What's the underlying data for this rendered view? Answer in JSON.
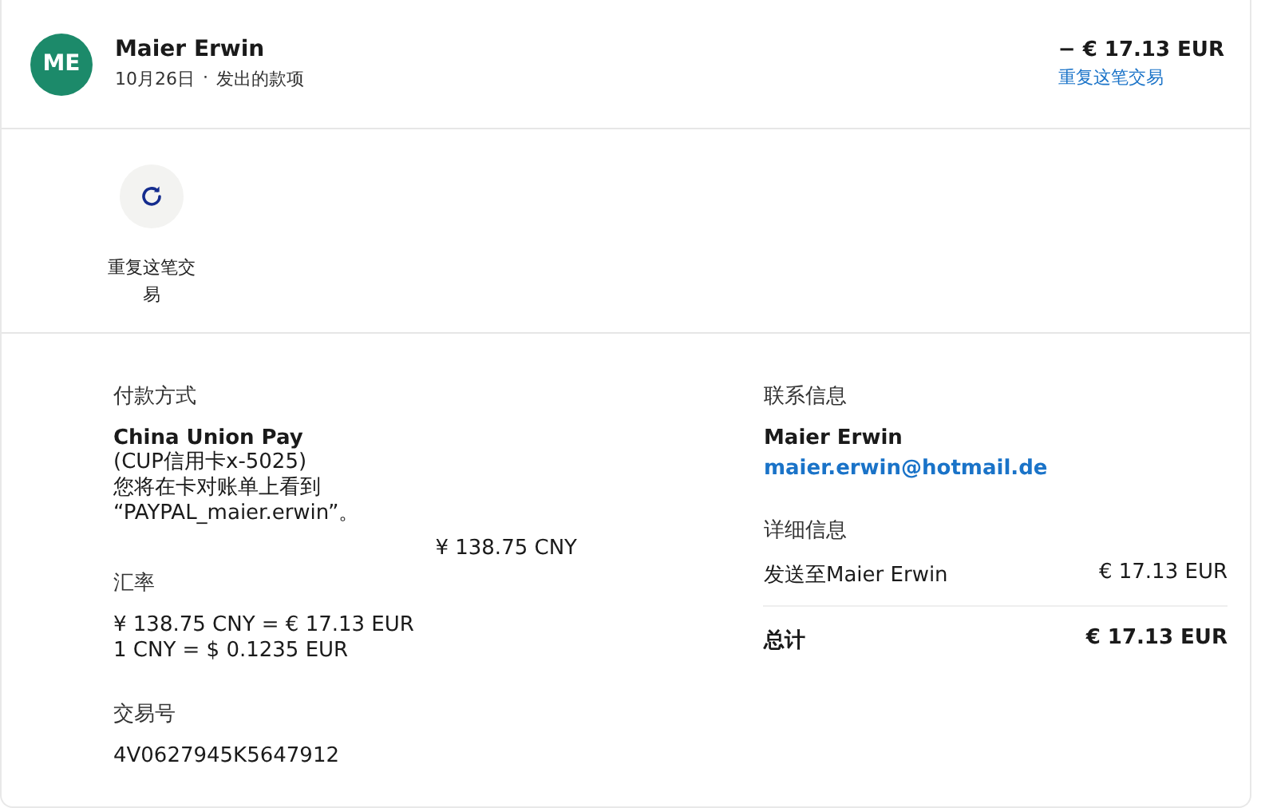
{
  "header": {
    "avatar": "ME",
    "name": "Maier Erwin",
    "date": "10月26日",
    "separator": "·",
    "type": "发出的款项",
    "amount": "− € 17.13 EUR",
    "repeat_link": "重复这笔交易"
  },
  "action": {
    "label": "重复这笔交易"
  },
  "payment": {
    "heading": "付款方式",
    "method": "China Union Pay",
    "card": "(CUP信用卡x-5025)",
    "statement_note": "您将在卡对账单上看到",
    "statement_name": "“PAYPAL_maier.erwin”。",
    "amount": "¥ 138.75 CNY"
  },
  "exchange": {
    "heading": "汇率",
    "conversion": "¥ 138.75 CNY = € 17.13 EUR",
    "rate": "1 CNY = $ 0.1235 EUR"
  },
  "transaction": {
    "heading": "交易号",
    "id": "4V0627945K5647912"
  },
  "contact": {
    "heading": "联系信息",
    "name": "Maier Erwin",
    "email": "maier.erwin@hotmail.de"
  },
  "details": {
    "heading": "详细信息",
    "rows": [
      {
        "label": "发送至Maier Erwin",
        "value": "€ 17.13 EUR"
      }
    ],
    "total_label": "总计",
    "total_value": "€ 17.13 EUR"
  }
}
